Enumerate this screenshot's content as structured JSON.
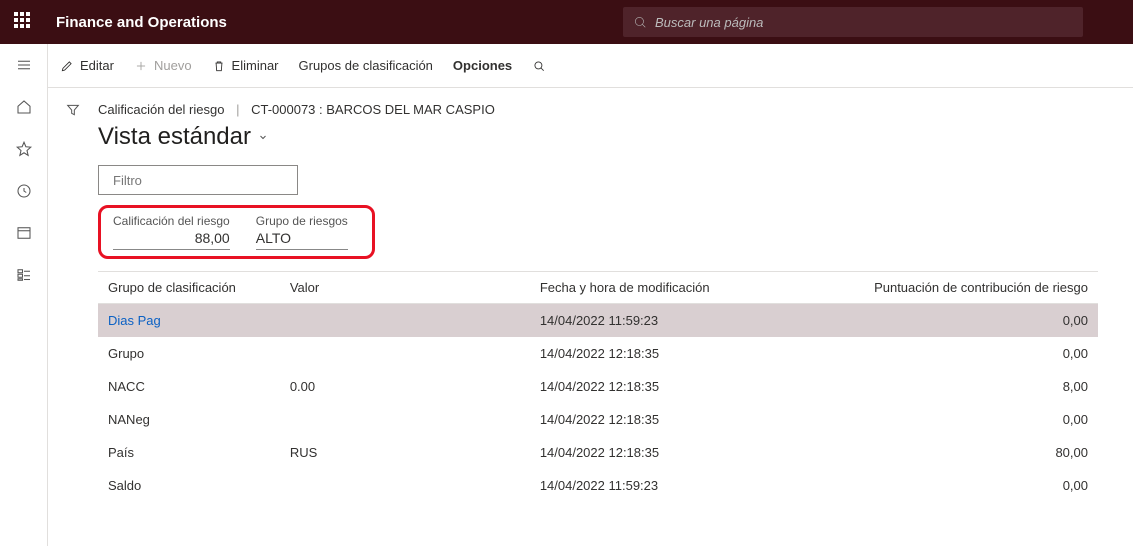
{
  "header": {
    "app_title": "Finance and Operations",
    "search_placeholder": "Buscar una página"
  },
  "action_bar": {
    "edit": "Editar",
    "new": "Nuevo",
    "delete": "Eliminar",
    "groups": "Grupos de clasificación",
    "options": "Opciones"
  },
  "breadcrumb": {
    "section": "Calificación del riesgo",
    "record": "CT-000073 : BARCOS DEL MAR CASPIO"
  },
  "view_title": "Vista estándar",
  "filter_placeholder": "Filtro",
  "risk_fields": {
    "score_label": "Calificación del riesgo",
    "score_value": "88,00",
    "group_label": "Grupo de riesgos",
    "group_value": "ALTO"
  },
  "table": {
    "headers": {
      "group": "Grupo de clasificación",
      "value": "Valor",
      "modified": "Fecha y hora de modificación",
      "score": "Puntuación de contribución de riesgo"
    },
    "rows": [
      {
        "group": "Dias Pag",
        "value": "",
        "modified": "14/04/2022 11:59:23",
        "score": "0,00",
        "selected": true
      },
      {
        "group": "Grupo",
        "value": "",
        "modified": "14/04/2022 12:18:35",
        "score": "0,00",
        "selected": false
      },
      {
        "group": "NACC",
        "value": "0.00",
        "modified": "14/04/2022 12:18:35",
        "score": "8,00",
        "selected": false
      },
      {
        "group": "NANeg",
        "value": "",
        "modified": "14/04/2022 12:18:35",
        "score": "0,00",
        "selected": false
      },
      {
        "group": "País",
        "value": "RUS",
        "modified": "14/04/2022 12:18:35",
        "score": "80,00",
        "selected": false
      },
      {
        "group": "Saldo",
        "value": "",
        "modified": "14/04/2022 11:59:23",
        "score": "0,00",
        "selected": false
      }
    ]
  }
}
